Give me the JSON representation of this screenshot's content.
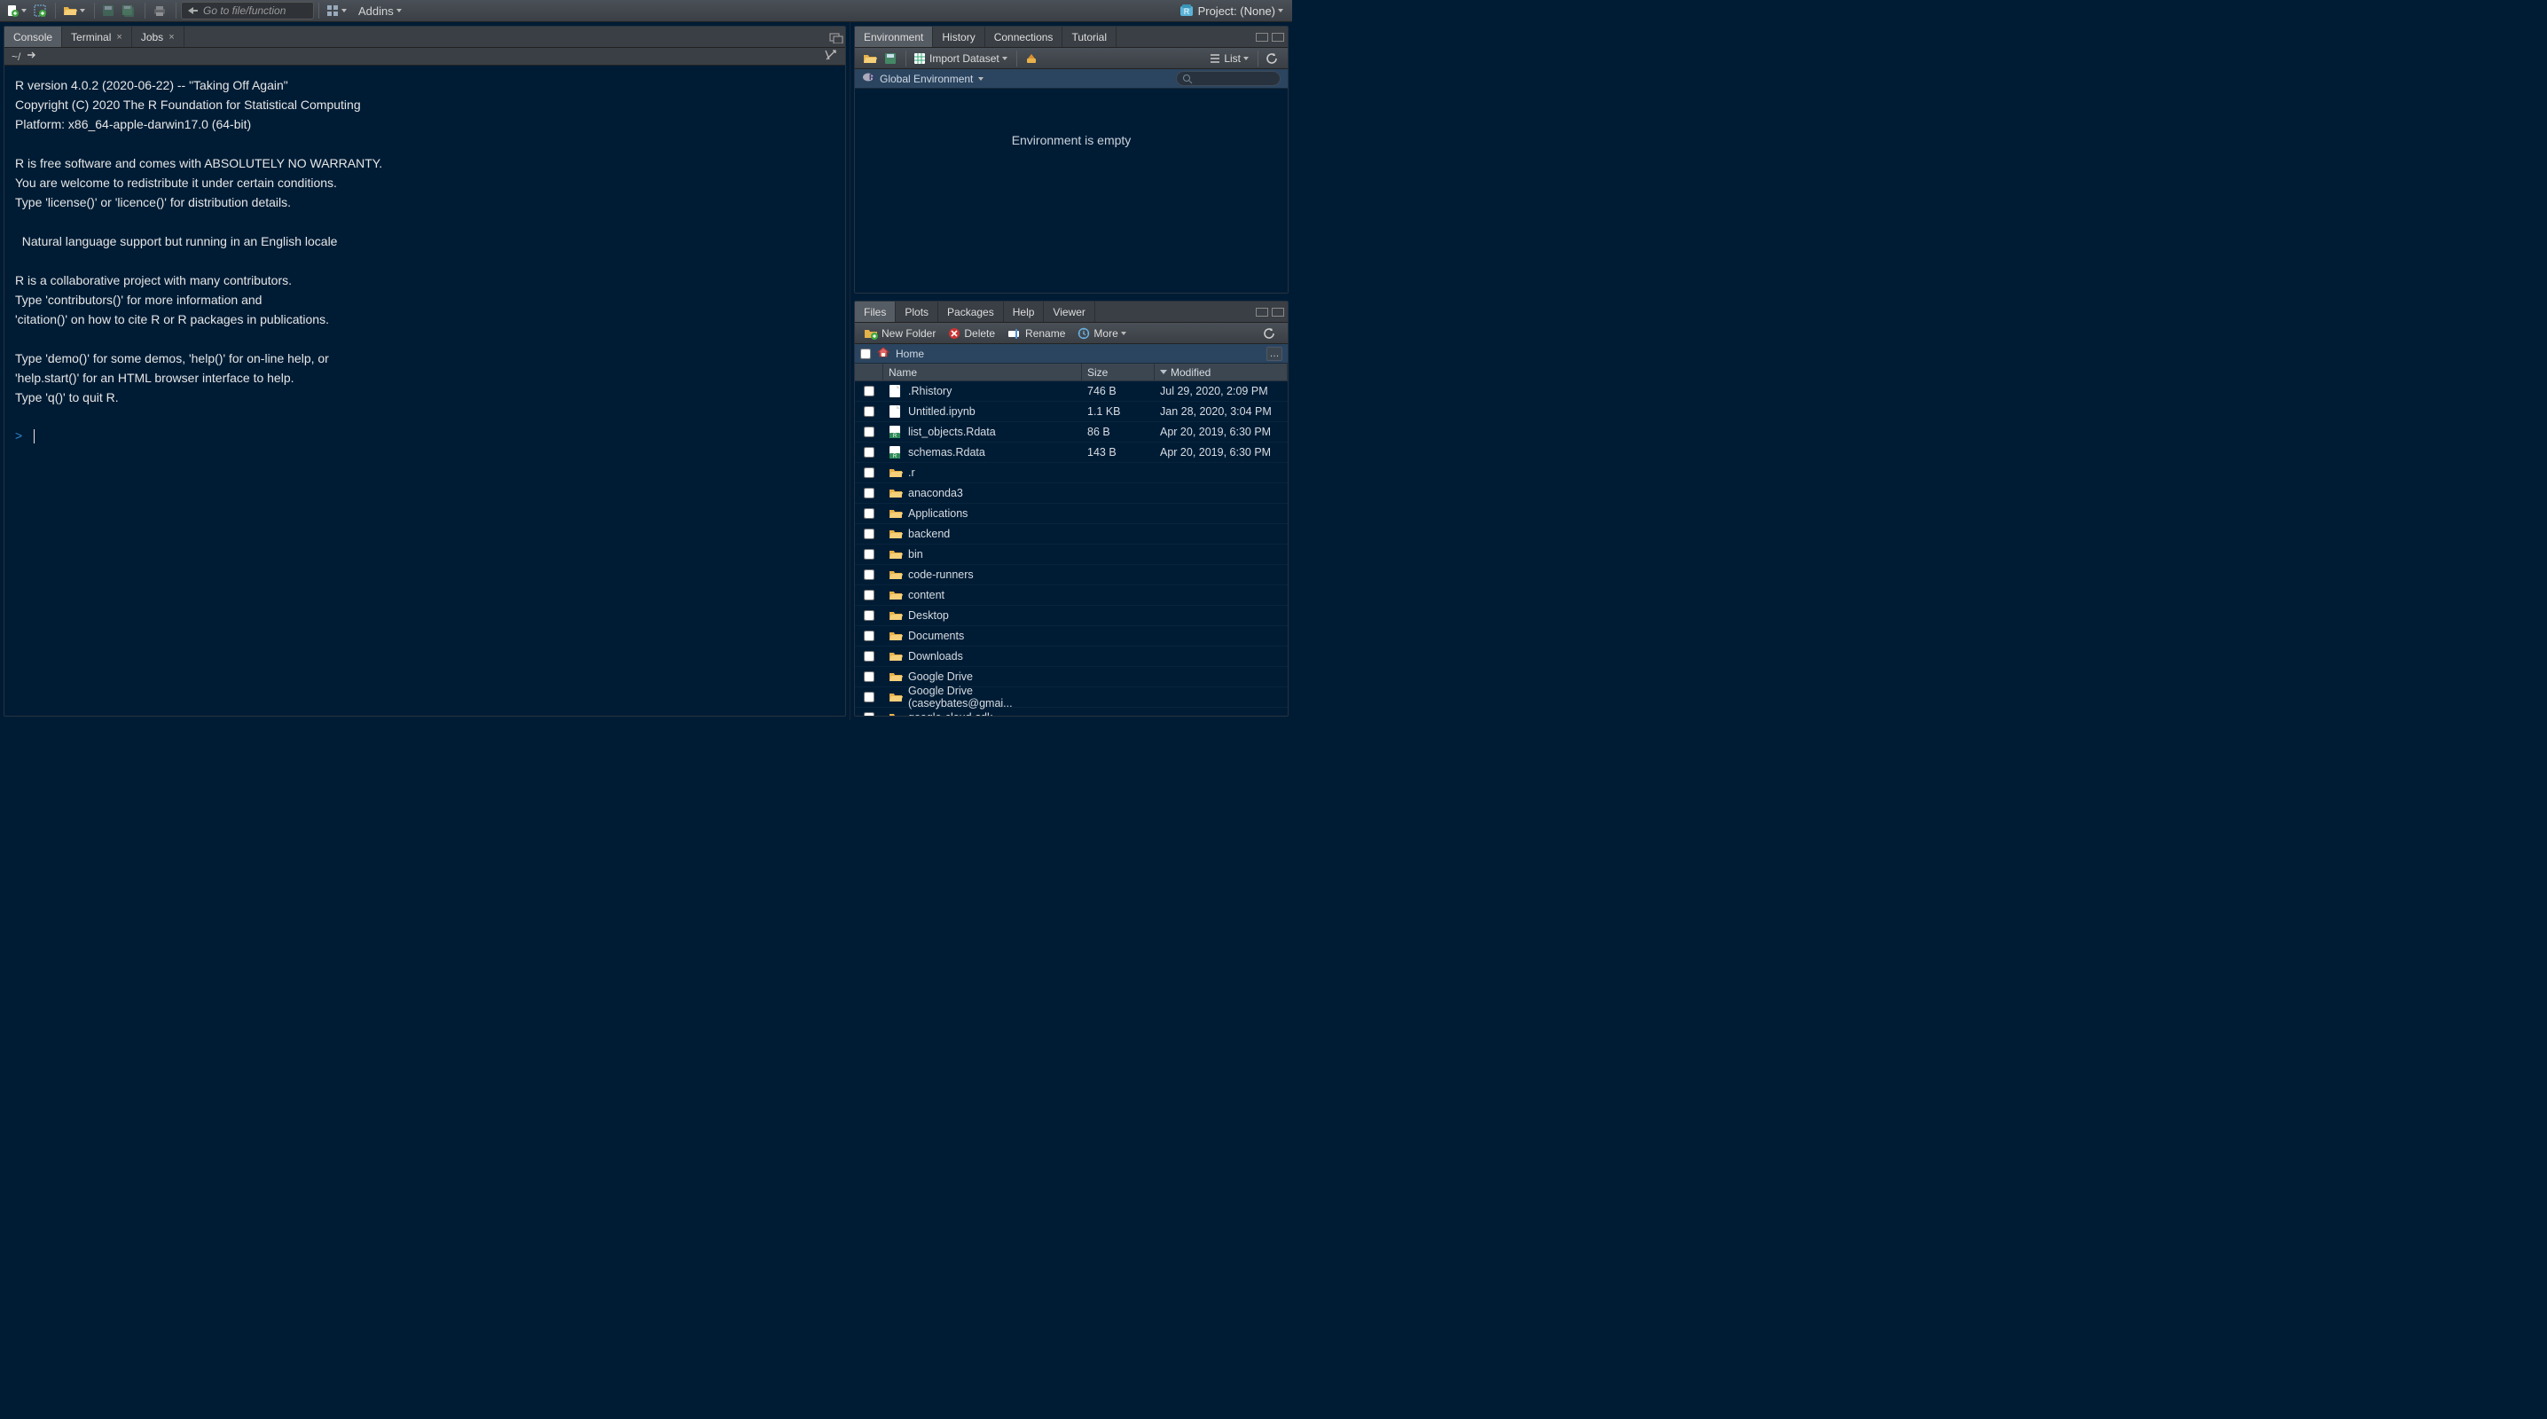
{
  "toolbar": {
    "goto_placeholder": "Go to file/function",
    "addins_label": "Addins",
    "project_label": "Project: (None)"
  },
  "console": {
    "tabs": [
      {
        "label": "Console",
        "closable": false,
        "active": true
      },
      {
        "label": "Terminal",
        "closable": true,
        "active": false
      },
      {
        "label": "Jobs",
        "closable": true,
        "active": false
      }
    ],
    "path": "~/",
    "text": "R version 4.0.2 (2020-06-22) -- \"Taking Off Again\"\nCopyright (C) 2020 The R Foundation for Statistical Computing\nPlatform: x86_64-apple-darwin17.0 (64-bit)\n\nR is free software and comes with ABSOLUTELY NO WARRANTY.\nYou are welcome to redistribute it under certain conditions.\nType 'license()' or 'licence()' for distribution details.\n\n  Natural language support but running in an English locale\n\nR is a collaborative project with many contributors.\nType 'contributors()' for more information and\n'citation()' on how to cite R or R packages in publications.\n\nType 'demo()' for some demos, 'help()' for on-line help, or\n'help.start()' for an HTML browser interface to help.\nType 'q()' to quit R.\n",
    "prompt": ">"
  },
  "env": {
    "tabs": [
      {
        "label": "Environment",
        "active": true
      },
      {
        "label": "History",
        "active": false
      },
      {
        "label": "Connections",
        "active": false
      },
      {
        "label": "Tutorial",
        "active": false
      }
    ],
    "import_label": "Import Dataset",
    "list_label": "List",
    "scope_label": "Global Environment",
    "empty_label": "Environment is empty"
  },
  "files": {
    "tabs": [
      {
        "label": "Files",
        "active": true
      },
      {
        "label": "Plots",
        "active": false
      },
      {
        "label": "Packages",
        "active": false
      },
      {
        "label": "Help",
        "active": false
      },
      {
        "label": "Viewer",
        "active": false
      }
    ],
    "actions": {
      "new_folder": "New Folder",
      "delete": "Delete",
      "rename": "Rename",
      "more": "More"
    },
    "breadcrumb": "Home",
    "columns": {
      "name": "Name",
      "size": "Size",
      "modified": "Modified"
    },
    "rows": [
      {
        "icon": "file",
        "name": ".Rhistory",
        "size": "746 B",
        "modified": "Jul 29, 2020, 2:09 PM"
      },
      {
        "icon": "file",
        "name": "Untitled.ipynb",
        "size": "1.1 KB",
        "modified": "Jan 28, 2020, 3:04 PM"
      },
      {
        "icon": "rdata",
        "name": "list_objects.Rdata",
        "size": "86 B",
        "modified": "Apr 20, 2019, 6:30 PM"
      },
      {
        "icon": "rdata",
        "name": "schemas.Rdata",
        "size": "143 B",
        "modified": "Apr 20, 2019, 6:30 PM"
      },
      {
        "icon": "folder",
        "name": ".r",
        "size": "",
        "modified": ""
      },
      {
        "icon": "folder",
        "name": "anaconda3",
        "size": "",
        "modified": ""
      },
      {
        "icon": "folder",
        "name": "Applications",
        "size": "",
        "modified": ""
      },
      {
        "icon": "folder",
        "name": "backend",
        "size": "",
        "modified": ""
      },
      {
        "icon": "folder",
        "name": "bin",
        "size": "",
        "modified": ""
      },
      {
        "icon": "folder",
        "name": "code-runners",
        "size": "",
        "modified": ""
      },
      {
        "icon": "folder",
        "name": "content",
        "size": "",
        "modified": ""
      },
      {
        "icon": "folder",
        "name": "Desktop",
        "size": "",
        "modified": ""
      },
      {
        "icon": "folder",
        "name": "Documents",
        "size": "",
        "modified": ""
      },
      {
        "icon": "folder",
        "name": "Downloads",
        "size": "",
        "modified": ""
      },
      {
        "icon": "folder",
        "name": "Google Drive",
        "size": "",
        "modified": ""
      },
      {
        "icon": "folder",
        "name": "Google Drive (caseybates@gmai...",
        "size": "",
        "modified": ""
      },
      {
        "icon": "folder",
        "name": "google-cloud-sdk",
        "size": "",
        "modified": ""
      }
    ]
  }
}
